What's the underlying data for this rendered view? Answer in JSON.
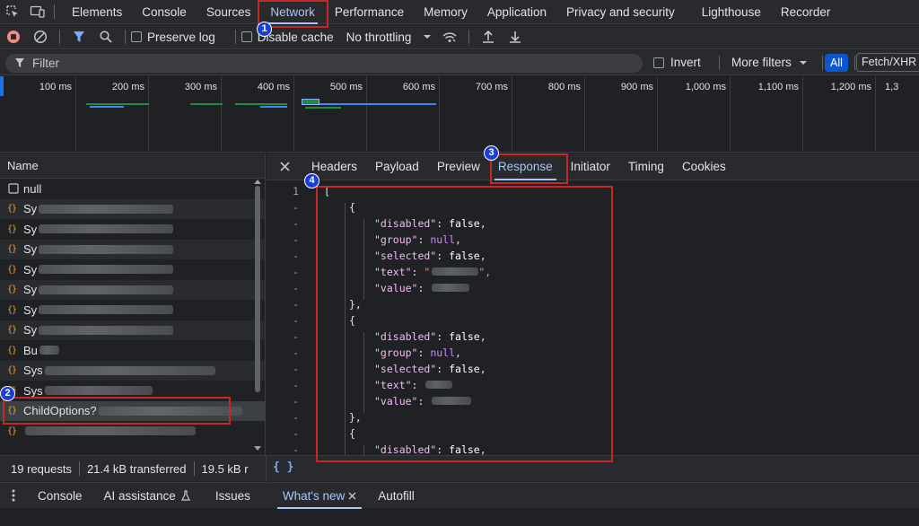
{
  "main_tabs": [
    {
      "label": "Elements"
    },
    {
      "label": "Console"
    },
    {
      "label": "Sources"
    },
    {
      "label": "Network",
      "active": true
    },
    {
      "label": "Performance"
    },
    {
      "label": "Memory"
    },
    {
      "label": "Application"
    },
    {
      "label": "Privacy and security"
    },
    {
      "label": "Lighthouse"
    },
    {
      "label": "Recorder"
    }
  ],
  "toolbar": {
    "preserve_log": "Preserve log",
    "disable_cache": "Disable cache",
    "throttling": "No throttling"
  },
  "filterbar": {
    "placeholder": "Filter",
    "invert": "Invert",
    "more_filters": "More filters",
    "all": "All",
    "fetch_xhr": "Fetch/XHR"
  },
  "timeline": {
    "ticks": [
      "100 ms",
      "200 ms",
      "300 ms",
      "400 ms",
      "500 ms",
      "600 ms",
      "700 ms",
      "800 ms",
      "900 ms",
      "1,000 ms",
      "1,100 ms",
      "1,200 ms",
      "1,3"
    ]
  },
  "request_list": {
    "header": "Name",
    "items": [
      {
        "label": "null",
        "icon": "doc-icon"
      },
      {
        "label": "Sy",
        "icon": "json-icon"
      },
      {
        "label": "Sy",
        "icon": "json-icon"
      },
      {
        "label": "Sy",
        "icon": "json-icon"
      },
      {
        "label": "Sy",
        "icon": "json-icon"
      },
      {
        "label": "Sy",
        "icon": "json-icon"
      },
      {
        "label": "Sy",
        "icon": "json-icon"
      },
      {
        "label": "Sy",
        "icon": "json-icon"
      },
      {
        "label": "Bu",
        "icon": "json-icon"
      },
      {
        "label": "Sys",
        "icon": "json-icon"
      },
      {
        "label": "Sys",
        "icon": "json-icon"
      },
      {
        "label": "ChildOptions?",
        "icon": "json-icon",
        "selected": true
      },
      {
        "label": "",
        "icon": "json-icon"
      }
    ]
  },
  "detail_tabs": [
    {
      "label": "Headers"
    },
    {
      "label": "Payload"
    },
    {
      "label": "Preview"
    },
    {
      "label": "Response",
      "active": true
    },
    {
      "label": "Initiator"
    },
    {
      "label": "Timing"
    },
    {
      "label": "Cookies"
    }
  ],
  "response": {
    "first_line_number": "1",
    "fold_marker": "-",
    "open_bracket": "[",
    "keys": {
      "disabled": "\"disabled\"",
      "group": "\"group\"",
      "selected": "\"selected\"",
      "text": "\"text\"",
      "value": "\"value\""
    },
    "false": "false",
    "null": "null",
    "redacted_text": "\"",
    "redacted_close": "\","
  },
  "status": {
    "requests": "19 requests",
    "transferred": "21.4 kB transferred",
    "resources": "19.5 kB r",
    "format": "{ }"
  },
  "drawer_tabs": [
    {
      "label": "Console"
    },
    {
      "label": "AI assistance"
    },
    {
      "label": "Issues"
    },
    {
      "label": "What's new",
      "active": true
    },
    {
      "label": "Autofill"
    }
  ],
  "annotations": [
    "1",
    "2",
    "3",
    "4"
  ],
  "colors": {
    "accent": "#a8c7fa",
    "annotation_red": "#c62828",
    "annotation_badge": "#1a3fd8"
  }
}
